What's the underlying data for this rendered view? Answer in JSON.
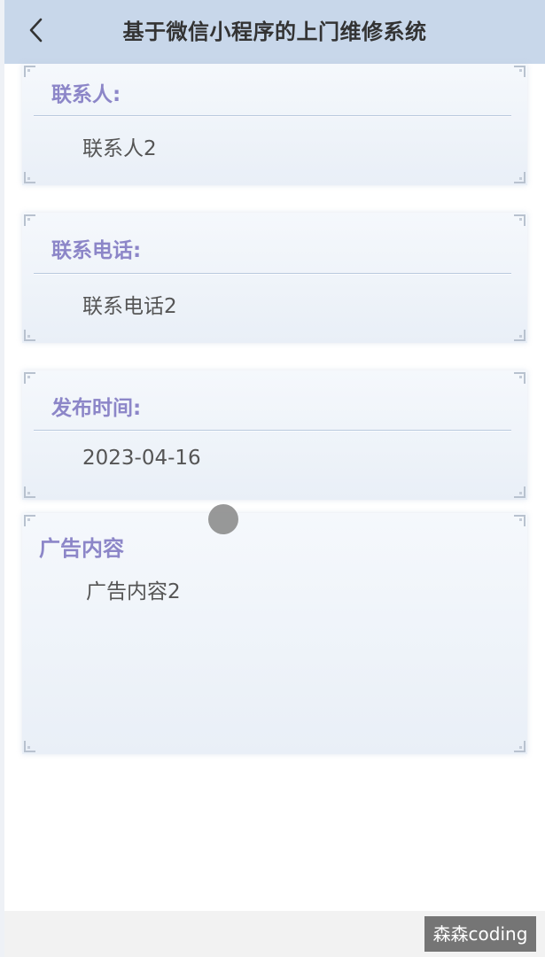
{
  "header": {
    "title": "基于微信小程序的上门维修系统",
    "back_icon": "chevron-left-icon"
  },
  "fields": [
    {
      "label": "联系人:",
      "value": "联系人2"
    },
    {
      "label": "联系电话:",
      "value": "联系电话2"
    },
    {
      "label": "发布时间:",
      "value": "2023-04-16"
    }
  ],
  "ad": {
    "label": "广告内容",
    "content": "广告内容2"
  },
  "watermark": "森森coding",
  "colors": {
    "header_bg": "#c8d7ea",
    "label_color": "#8c86c8",
    "value_color": "#555555"
  }
}
